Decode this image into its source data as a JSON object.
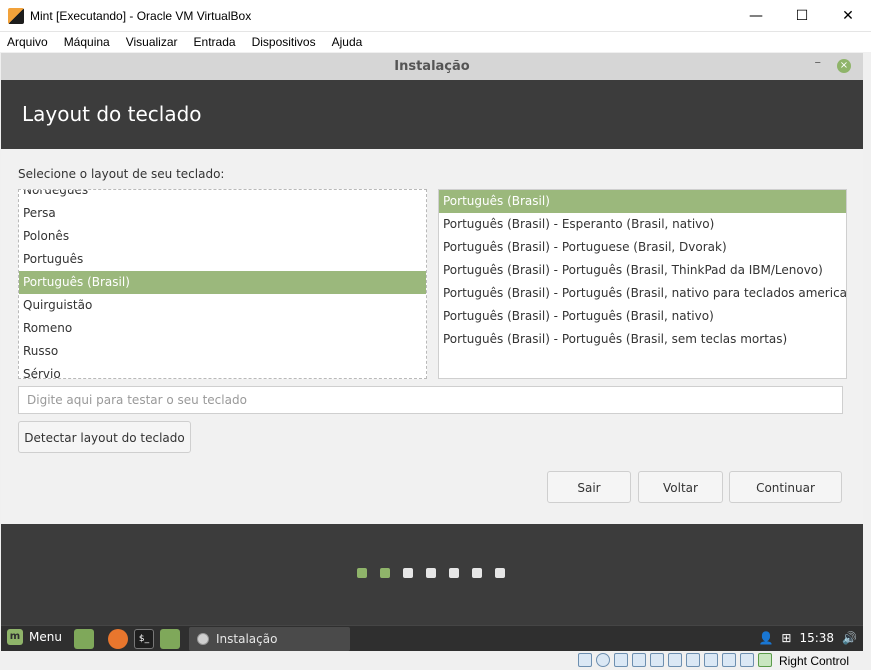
{
  "window": {
    "title": "Mint [Executando] - Oracle VM VirtualBox",
    "minimize": "—",
    "maximize": "☐",
    "close": "✕"
  },
  "host_menu": [
    "Arquivo",
    "Máquina",
    "Visualizar",
    "Entrada",
    "Dispositivos",
    "Ajuda"
  ],
  "installer": {
    "title": "Instalação",
    "minimize": "–",
    "close": "×",
    "heading": "Layout do teclado",
    "prompt": "Selecione o layout de seu teclado:",
    "layouts": [
      "Norueguês",
      "Persa",
      "Polonês",
      "Português",
      "Português (Brasil)",
      "Quirguistão",
      "Romeno",
      "Russo",
      "Sérvio"
    ],
    "selected_layout": "Português (Brasil)",
    "variants": [
      "Português (Brasil)",
      "Português (Brasil) - Esperanto (Brasil, nativo)",
      "Português (Brasil) - Portuguese (Brasil, Dvorak)",
      "Português (Brasil) - Português (Brasil, ThinkPad da IBM/Lenovo)",
      "Português (Brasil) - Português (Brasil, nativo para teclados americanos)",
      "Português (Brasil) - Português (Brasil, nativo)",
      "Português (Brasil) - Português (Brasil, sem teclas mortas)"
    ],
    "selected_variant": "Português (Brasil)",
    "test_placeholder": "Digite aqui para testar o seu teclado",
    "detect_button": "Detectar layout do teclado",
    "quit_button": "Sair",
    "back_button": "Voltar",
    "continue_button": "Continuar",
    "progress": {
      "total_steps": 7,
      "completed_steps": 2
    }
  },
  "panel": {
    "menu_label": "Menu",
    "task_label": "Instalação",
    "clock": "15:38"
  },
  "statusbar": {
    "host_key": "Right Control"
  },
  "colors": {
    "accent": "#9bb87c",
    "header_bg": "#3c3c3c",
    "panel_bg": "#2f2f2f"
  }
}
